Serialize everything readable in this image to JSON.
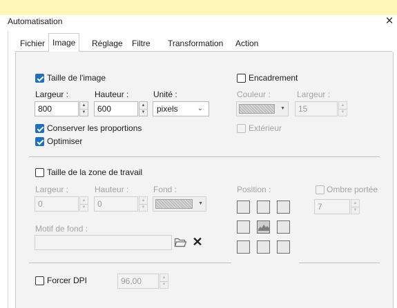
{
  "window": {
    "title": "Automatisation",
    "close_glyph": "✕"
  },
  "tabs": [
    {
      "label": "Fichier"
    },
    {
      "label": "Image",
      "active": true
    },
    {
      "label": "Réglage"
    },
    {
      "label": "Filtre"
    },
    {
      "label": "Transformation"
    },
    {
      "label": "Action"
    }
  ],
  "image_size": {
    "label": "Taille de l'image",
    "checked": true,
    "width_label": "Largeur :",
    "width_value": "800",
    "height_label": "Hauteur :",
    "height_value": "600",
    "unit_label": "Unité :",
    "unit_value": "pixels",
    "keep_ratio_label": "Conserver les proportions",
    "keep_ratio_checked": true,
    "optimize_label": "Optimiser",
    "optimize_checked": true
  },
  "frame": {
    "label": "Encadrement",
    "checked": false,
    "color_label": "Couleur :",
    "width_label": "Largeur :",
    "width_value": "15",
    "exterior_label": "Extérieur",
    "exterior_checked": false
  },
  "workspace": {
    "label": "Taille de la zone de travail",
    "checked": false,
    "width_label": "Largeur :",
    "width_value": "0",
    "height_label": "Hauteur :",
    "height_value": "0",
    "background_label": "Fond :",
    "position_label": "Position :",
    "shadow_label": "Ombre portée",
    "shadow_checked": false,
    "shadow_value": "7",
    "pattern_label": "Motif de fond :",
    "pattern_value": ""
  },
  "dpi": {
    "label": "Forcer DPI",
    "checked": false,
    "value": "96,00"
  },
  "colors": {
    "accent": "#1f6fbf",
    "panel": "#f3f3f3",
    "titlebar": "#fff6b8"
  }
}
